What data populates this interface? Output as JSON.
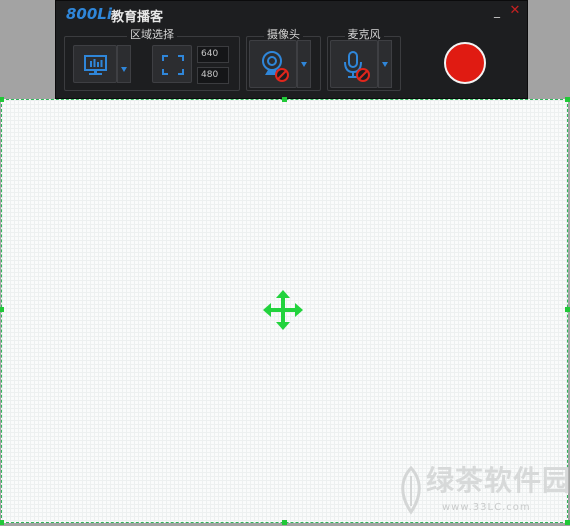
{
  "app": {
    "logo_text": "800Li",
    "title": "教育播客"
  },
  "window_controls": {
    "minimize_symbol": "_",
    "close_symbol": "✕"
  },
  "groups": {
    "region_select": {
      "label": "区域选择",
      "width_value": "640",
      "height_value": "480"
    },
    "camera": {
      "label": "摄像头",
      "state": "disabled"
    },
    "microphone": {
      "label": "麦克风",
      "state": "disabled"
    }
  },
  "record": {
    "state": "idle"
  },
  "watermark": {
    "text": "绿茶软件园",
    "url": "www.33LC.com"
  },
  "colors": {
    "accent_blue": "#2f86d9",
    "record_red": "#e01b12",
    "region_border_green": "#21c838",
    "disabled_red": "#e0261c"
  },
  "icons": [
    "monitor-icon",
    "fullscreen-icon",
    "webcam-icon",
    "microphone-icon",
    "move-cursor-icon",
    "leaf-logo-icon"
  ]
}
